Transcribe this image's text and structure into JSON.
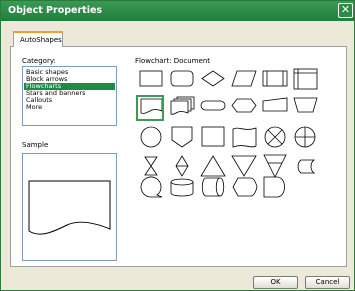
{
  "window": {
    "title": "Object Properties",
    "close_glyph": "✕"
  },
  "tabs": [
    {
      "label": "AutoShapes"
    }
  ],
  "category": {
    "label": "Category:",
    "items": [
      "Basic shapes",
      "Block arrows",
      "Flowcharts",
      "Stars and banners",
      "Callouts",
      "More"
    ],
    "selected": "Flowcharts"
  },
  "sample": {
    "label": "Sample"
  },
  "shapes": {
    "title": "Flowchart: Document",
    "items": [
      "process",
      "alternate-process",
      "decision",
      "data",
      "predefined-process",
      "internal-storage",
      "document",
      "multidocument",
      "terminator",
      "preparation",
      "manual-input",
      "manual-operation",
      "connector",
      "off-page-connector",
      "card",
      "punched-tape",
      "summing-junction",
      "or",
      "collate",
      "sort",
      "extract",
      "merge",
      "stored-data",
      "delay",
      "sequential-access-storage",
      "magnetic-disk",
      "direct-access-storage",
      "display",
      "delay"
    ],
    "selected": "document"
  },
  "buttons": {
    "ok": "OK",
    "cancel": "Cancel"
  },
  "colors": {
    "accent": "#1e8a48",
    "titlebar": "#2a8a46",
    "tab_highlight": "#f0a030"
  }
}
